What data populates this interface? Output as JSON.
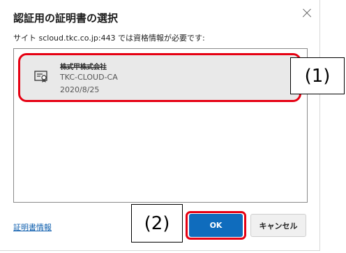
{
  "dialog": {
    "title": "認証用の証明書の選択",
    "subtitle": "サイト scloud.tkc.co.jp:443 では資格情報が必要です:",
    "certificate": {
      "name": "株式甲株式会社",
      "issuer": "TKC-CLOUD-CA",
      "date": "2020/8/25",
      "icon": "certificate-icon"
    },
    "cert_info_link": "証明書情報",
    "ok_label": "OK",
    "cancel_label": "キャンセル",
    "close_icon": "close-icon"
  },
  "annotations": {
    "callout_1": "(1)",
    "callout_2": "(2)"
  },
  "colors": {
    "highlight": "#e60012",
    "primary_button": "#0f6cbd",
    "selected_item_bg": "#e9e9e9"
  }
}
